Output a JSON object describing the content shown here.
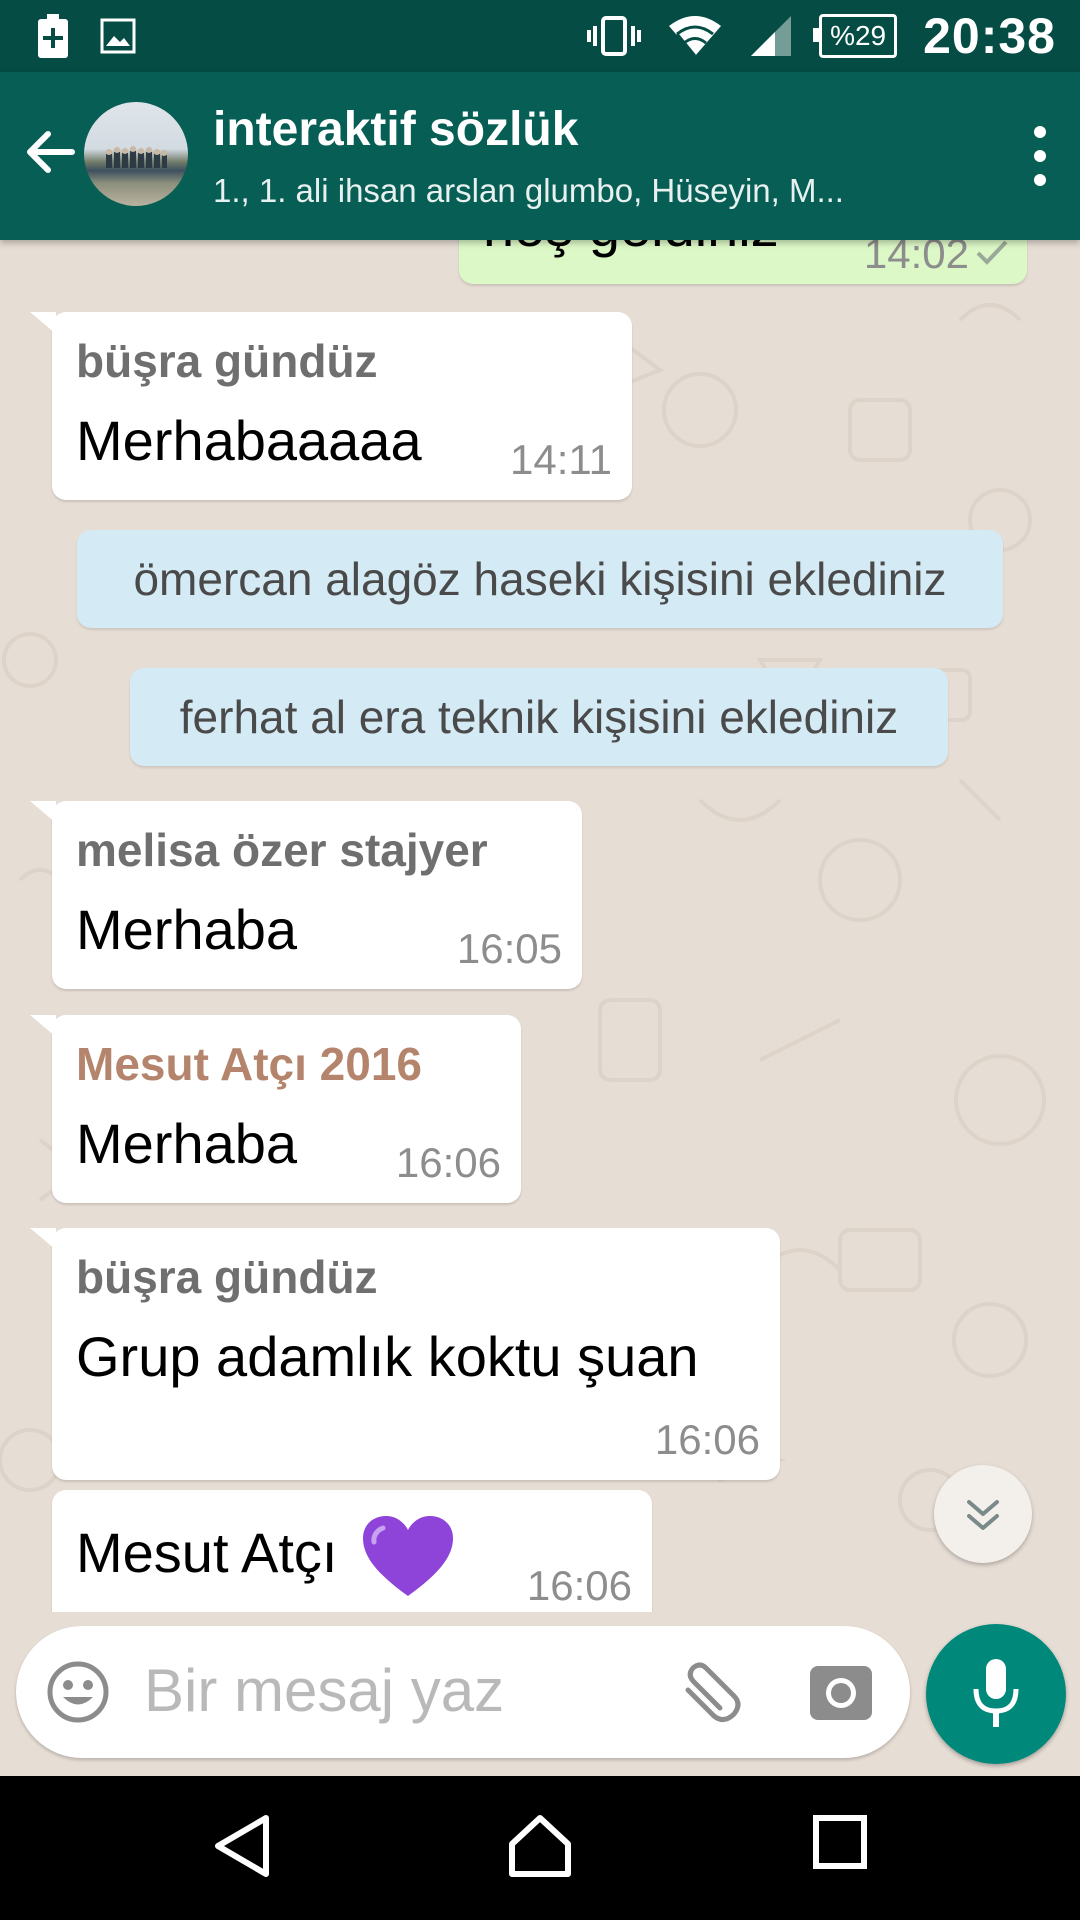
{
  "status_bar": {
    "battery": "%29",
    "time": "20:38"
  },
  "header": {
    "title": "interaktif sözlük",
    "subtitle": "1., 1. ali ihsan arslan glumbo, Hüseyin, M..."
  },
  "messages": {
    "m0": {
      "text": "hoş geldiniz",
      "time": "14:02"
    },
    "m1": {
      "sender": "büşra gündüz",
      "text": "Merhabaaaaa",
      "time": "14:11"
    },
    "s1": {
      "text": "ömercan alagöz haseki kişisini eklediniz"
    },
    "s2": {
      "text": "ferhat al era teknik kişisini eklediniz"
    },
    "m2": {
      "sender": "melisa özer stajyer",
      "text": "Merhaba",
      "time": "16:05"
    },
    "m3": {
      "sender": "Mesut Atçı 2016",
      "sender_color": "#b4856c",
      "text": "Merhaba",
      "time": "16:06"
    },
    "m4": {
      "sender": "büşra gündüz",
      "text": "Grup adamlık koktu şuan",
      "time": "16:06"
    },
    "m5": {
      "text": "Mesut Atçı",
      "emoji": "purple-heart",
      "time": "16:06"
    }
  },
  "composer": {
    "placeholder": "Bir mesaj yaz"
  },
  "colors": {
    "header": "#075e54",
    "status_bar": "#054d44",
    "outgoing_bubble": "#dcf8c6",
    "system_bubble": "#d4eaf4",
    "mic_button": "#00897b"
  }
}
